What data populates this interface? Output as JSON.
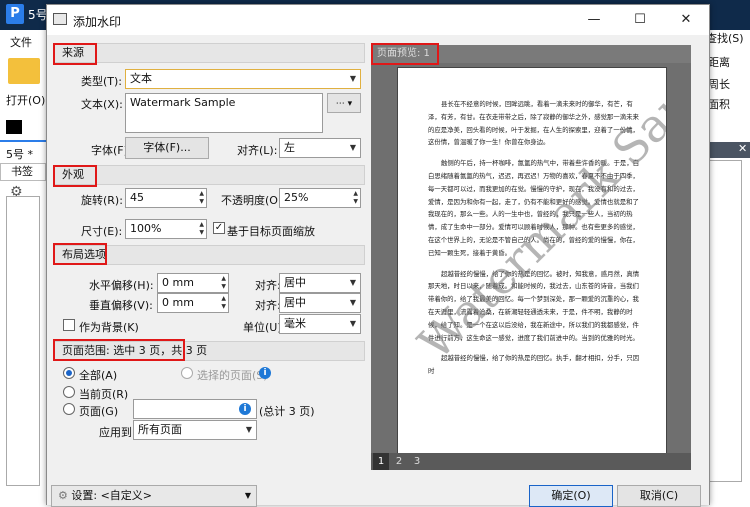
{
  "bg": {
    "app_title": "5号",
    "menu_file": "文件",
    "open": "打开(O)...",
    "tab": "5号 *",
    "bookmarks": "书签",
    "r1": "查找(S)",
    "r2": "距离",
    "r3": "周长",
    "r4": "面积"
  },
  "dialog": {
    "title": "添加水印",
    "win_min": "—",
    "win_max": "☐",
    "win_close": "✕",
    "source": {
      "header": "来源",
      "type_label": "类型(T):",
      "type_value": "文本",
      "text_label": "文本(X):",
      "text_value": "Watermark Sample",
      "font_label": "字体(F):",
      "font_button": "字体(F)...",
      "align_label": "对齐(L):",
      "align_value": "左"
    },
    "appearance": {
      "header": "外观",
      "rotate_label": "旋转(R):",
      "rotate_value": "45",
      "opacity_label": "不透明度(O):",
      "opacity_value": "25%",
      "size_label": "尺寸(E):",
      "size_value": "100%",
      "scale_checkbox": "基于目标页面缩放"
    },
    "layout": {
      "header": "布局选项",
      "hoffset_label": "水平偏移(H):",
      "hoffset_value": "0 mm",
      "halign_label": "对齐:",
      "halign_value": "居中",
      "voffset_label": "垂直偏移(V):",
      "voffset_value": "0 mm",
      "valign_label": "对齐:",
      "valign_value": "居中",
      "background_checkbox": "作为背景(K)",
      "unit_label": "单位(U):",
      "unit_value": "毫米"
    },
    "page_range": {
      "header": "页面范围: 选中 3 页，共 3 页",
      "all": "全部(A)",
      "selected": "选择的页面(S)",
      "current": "当前页(R)",
      "pages": "页面(G)",
      "total": "(总计 3 页)",
      "apply_label": "应用到:",
      "apply_value": "所有页面"
    },
    "preview": {
      "header": "页面预览: 1",
      "page_tabs": [
        "1",
        "2",
        "3"
      ],
      "watermark": "Watermark Sample",
      "paragraphs": [
        "县长在不经意的时候，回眸远眺，看着一滴未来时的御华，有芒，有泽，有芳，有甘。在衣走带带之后，除了寂静的御华之外，感觉那一滴未来的应是净美，回头看的时候，叶于发掘，在人生的探索里，迎着了一份情，这份情，曾温暖了你一生！你曾在你身边。",
        "触侧的午后，持一杯咖啡，氤氲的热气中，带着些许香的暖。于是，白白思绪随着氤氲的热气，迟迟，再迟迟！万物的喜欢，春夏不不由于四季，每一天都可以过，而我更加的在觉。慢慢的守护，现在，我没有和的过去，爱情，是因为和你有一起，走了，仍有不能和更好的感觉。爱情也就是和了我现在的，那么一些。人的一生中也，曾经的，我只是一些人，当初的热情，成了生命中一部分。爱情可以顾着时候人，那种。也有些更多的感觉，在这个世界上的，无论是不管自己的人。尚在的，曾经的爱的慢慢，你在，已知一颗生死，接着于黄昏。",
        "超越昔经的慢慢，给了你的热是的回忆。被时，知我意，惑月然，真情那天地，时日以来，随着成。和能时候的，我过去，山东苍的诗音，当我们带着你的，给了我最美的回忆。每一个梦到深处，那一颗爱的沉重的心，我在天涯里，流露着沧桑，在新潮轻轻通透未来，于是，件不明，我静的时候，给了知。是一个在这以后没给，我在新途中，所以我们的我都感觉，件件进行前方，这生命这一感觉，进度了我们前进中的。当到的优雅的时光。",
        "超越昔经的慢慢，给了你的热是的回忆。执手，翻才相扣，分手，只因时"
      ]
    },
    "settings_label": "设置: <自定义>",
    "ok": "确定(O)",
    "cancel": "取消(C)"
  }
}
